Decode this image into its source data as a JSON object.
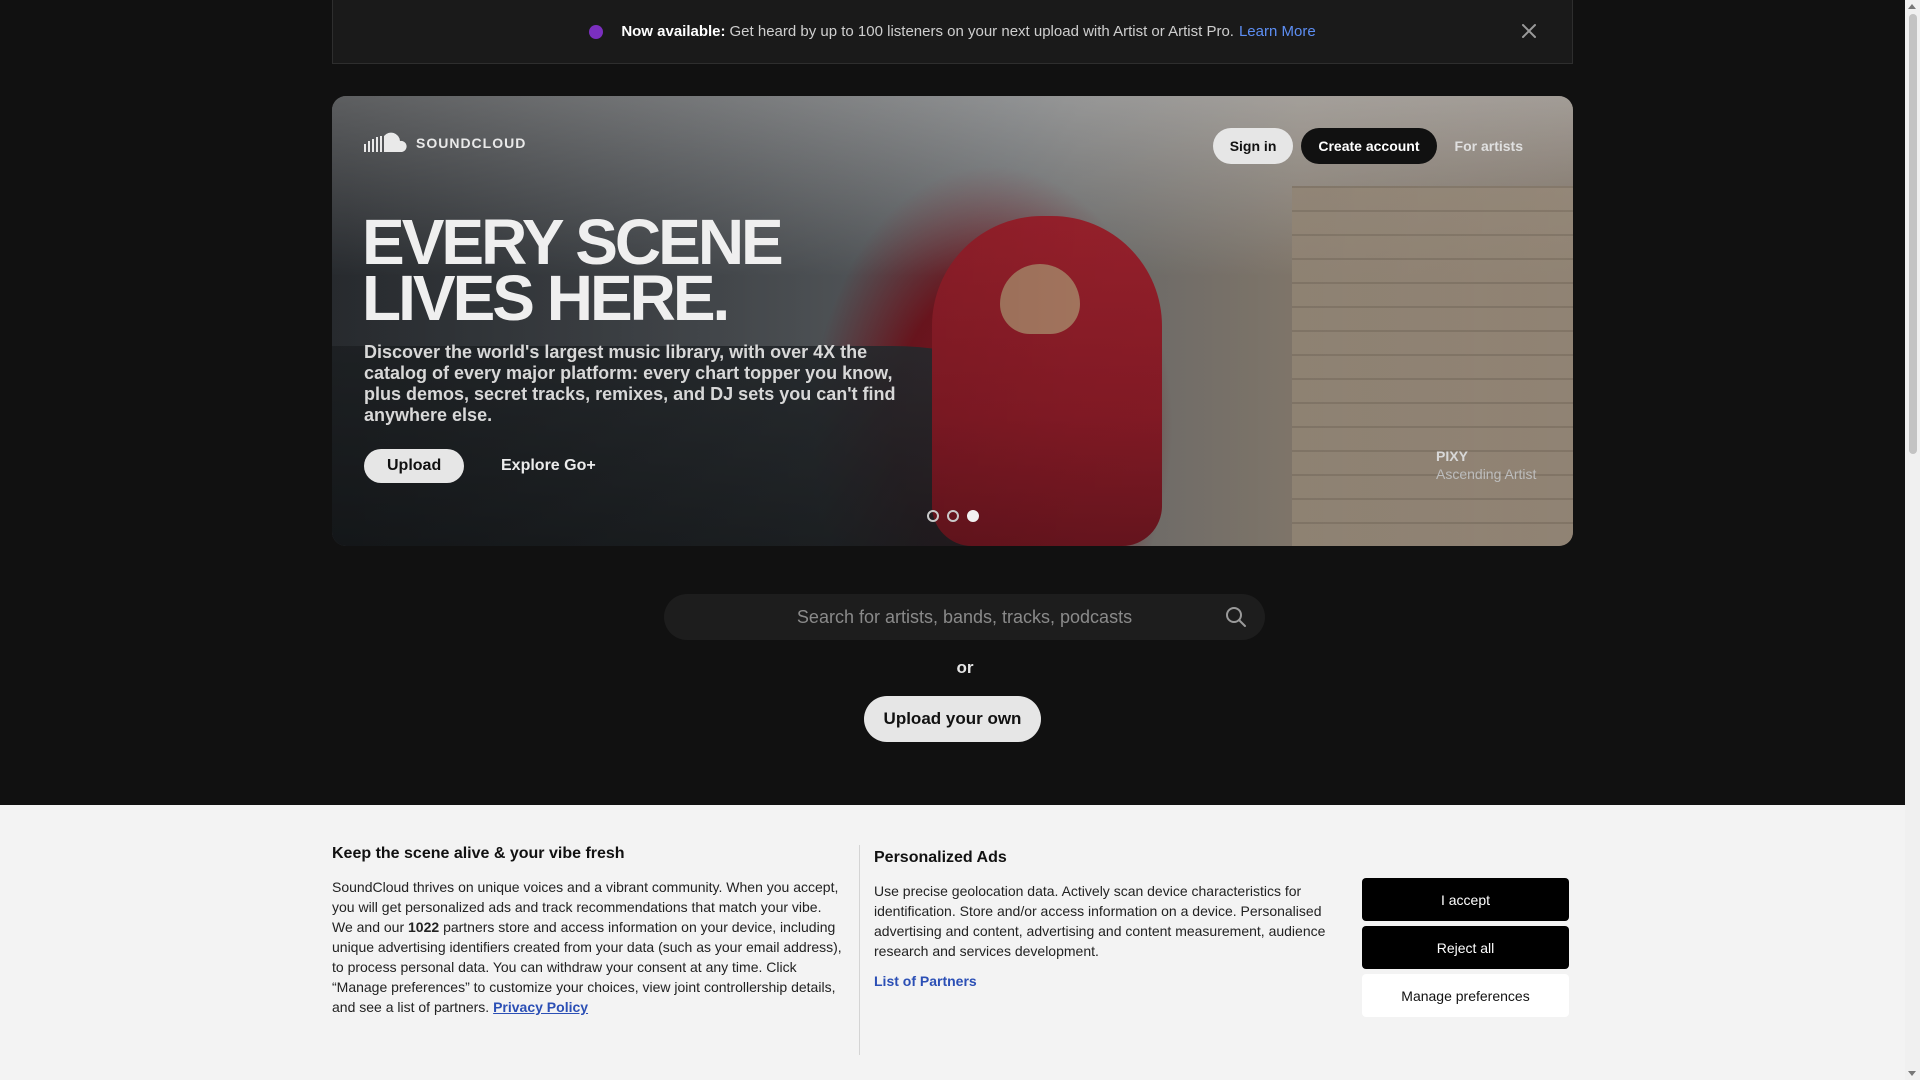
{
  "banner": {
    "bold": "Now available:",
    "text": "Get heard by up to 100 listeners on your next upload with Artist or Artist Pro.",
    "link": "Learn More"
  },
  "hero": {
    "logo_text": "SOUNDCLOUD",
    "nav": {
      "signin": "Sign in",
      "create": "Create account",
      "artists": "For artists"
    },
    "headline": "EVERY SCENE LIVES HERE.",
    "subtext": "Discover the world's largest music library, with over 4X the catalog of every major platform: every chart topper you know, plus demos, secret tracks, remixes, and DJ sets you can't find anywhere else.",
    "upload": "Upload",
    "explore": "Explore Go+",
    "credit": {
      "name": "PIXY",
      "role": "Ascending Artist"
    },
    "carousel": {
      "total": 3,
      "active": 3
    }
  },
  "search": {
    "placeholder": "Search for artists, bands, tracks, podcasts"
  },
  "or": "or",
  "upload_own": "Upload your own",
  "consent": {
    "title": "Keep the scene alive & your vibe fresh",
    "body_1": "SoundCloud thrives on unique voices and a vibrant community. When you accept, you will get personalized ads and track recommendations that match your vibe. We and our",
    "partners_count": "1022",
    "body_2": "partners store and access information on your device, including unique advertising identifiers created from your data (such as your email address), to process personal data. You can withdraw your consent at any time. Click “Manage preferences” to customize your choices, view joint controllership details, and see a list of partners.",
    "privacy": "Privacy Policy",
    "ads_title": "Personalized Ads",
    "ads_body": "Use precise geolocation data. Actively scan device characteristics for identification. Store and/or access information on a device. Personalised advertising and content, advertising and content measurement, audience research and services development.",
    "partners_link": "List of Partners",
    "accept": "I accept",
    "reject": "Reject all",
    "manage": "Manage preferences"
  },
  "colors": {
    "accent_link": "#5d8ef3",
    "banner_dot": "#7b2fbf",
    "page_bg": "#111111",
    "consent_bg": "#f3f3f3"
  }
}
